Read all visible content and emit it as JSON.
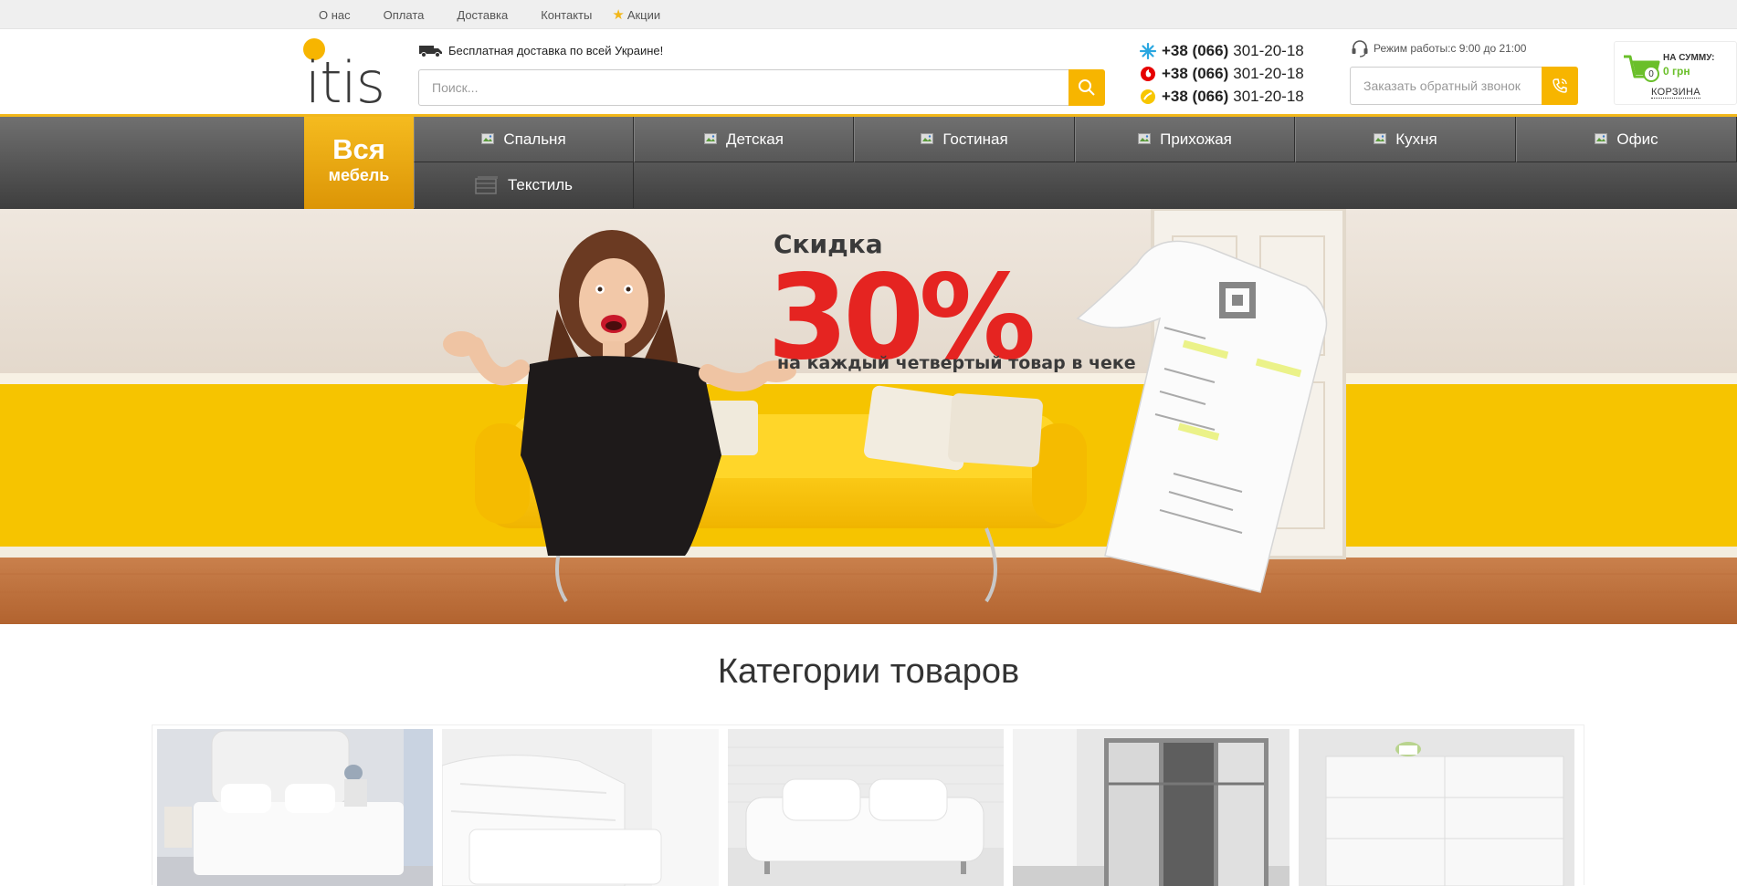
{
  "topnav": {
    "items": [
      "О нас",
      "Оплата",
      "Доставка",
      "Контакты"
    ],
    "promo": "Акции"
  },
  "header": {
    "logo_text": "itis",
    "delivery_text": "Бесплатная доставка по всей Украине!",
    "search_placeholder": "Поиск...",
    "phones": [
      {
        "code": "+38 (066)",
        "number": "301-20-18",
        "operator_color": "#2aa7e0"
      },
      {
        "code": "+38 (066)",
        "number": "301-20-18",
        "operator_color": "#e60000"
      },
      {
        "code": "+38 (066)",
        "number": "301-20-18",
        "operator_color": "#f7c600"
      }
    ],
    "hours": "Режим работы:с 9:00 до 21:00",
    "callback_placeholder": "Заказать обратный звонок",
    "cart": {
      "label": "НА СУММУ:",
      "sum": "0 грн",
      "count": "0",
      "link": "КОРЗИНА"
    }
  },
  "nav": {
    "all_big": "Вся",
    "all_small": "мебель",
    "items": [
      "Спальня",
      "Детская",
      "Гостиная",
      "Прихожая",
      "Кухня",
      "Офис",
      "Текстиль"
    ]
  },
  "banner": {
    "title": "Скидка",
    "percent": "30%",
    "subtitle": "на каждый четвертый товар в чеке"
  },
  "categories": {
    "title": "Категории товаров"
  },
  "colors": {
    "accent": "#f7b500",
    "discount_red": "#e52421",
    "cart_green": "#6abf2a"
  }
}
